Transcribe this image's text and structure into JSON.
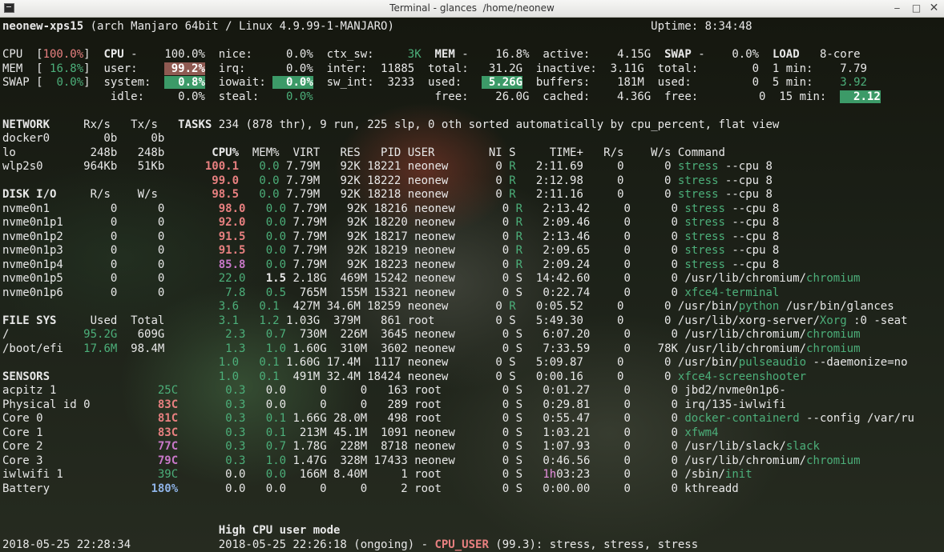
{
  "window": {
    "title": "Terminal - glances  /home/neonew"
  },
  "lines": [
    [
      {
        "t": "neonew-xps15",
        "c": "b"
      },
      {
        "t": " (arch Manjaro 64bit / Linux 4.9.99-1-MANJARO)                                      Uptime: 8:34:48"
      }
    ],
    [],
    [
      {
        "t": "CPU  ["
      },
      {
        "t": "100.0%",
        "c": "r"
      },
      {
        "t": "]  "
      },
      {
        "t": "CPU",
        "c": "b"
      },
      {
        "t": " -    100.0%  nice:     0.0%  ctx_sw:     "
      },
      {
        "t": "3K",
        "c": "g"
      },
      {
        "t": "  "
      },
      {
        "t": "MEM",
        "c": "b"
      },
      {
        "t": " -    16.8%  active:    4.15G  "
      },
      {
        "t": "SWAP",
        "c": "b"
      },
      {
        "t": " -    0.0%  "
      },
      {
        "t": "LOAD",
        "c": "b"
      },
      {
        "t": "   8-core"
      }
    ],
    [
      {
        "t": "MEM  [ "
      },
      {
        "t": "16.8%",
        "c": "g"
      },
      {
        "t": "]  user:    "
      },
      {
        "t": " 99.2%",
        "c": "hr b"
      },
      {
        "t": "  irq:      0.0%  inter:  11885  total:   31.2G  inactive:  3.11G  total:        0  1 min:    7.79"
      }
    ],
    [
      {
        "t": "SWAP [  "
      },
      {
        "t": "0.0%",
        "c": "g"
      },
      {
        "t": "]  system:  "
      },
      {
        "t": "  0.8%",
        "c": "hg b"
      },
      {
        "t": "  iowait: "
      },
      {
        "t": "  0.0%",
        "c": "hg b"
      },
      {
        "t": "  sw_int:  3233  used:   "
      },
      {
        "t": " 5.26G",
        "c": "hg b"
      },
      {
        "t": "  buffers:    181M  used:         0  5 min:    "
      },
      {
        "t": "3.92",
        "c": "g"
      }
    ],
    [
      {
        "t": "                idle:     0.0%  steal:    "
      },
      {
        "t": "0.0%",
        "c": "g"
      },
      {
        "t": "                  free:    26.0G  cached:    4.36G  free:         0  15 min:  "
      },
      {
        "t": "  2.12",
        "c": "hg b"
      }
    ],
    [],
    [
      {
        "t": "NETWORK",
        "c": "b"
      },
      {
        "t": "     Rx/s   Tx/s   "
      },
      {
        "t": "TASKS",
        "c": "b"
      },
      {
        "t": " 234 (878 thr), 9 run, 225 slp, 0 oth sorted automatically by cpu_percent, flat view"
      }
    ],
    [
      {
        "t": "docker0        0b     0b"
      }
    ],
    [
      {
        "t": "lo           248b   248b       "
      },
      {
        "t": "CPU%",
        "c": "b"
      },
      {
        "t": "  MEM%  VIRT   RES   PID USER        NI S     TIME+   R/s    W/s Command"
      }
    ],
    [
      {
        "t": "wlp2s0      964Kb   51Kb      "
      },
      {
        "t": "100.1",
        "c": "r b"
      },
      {
        "t": "   "
      },
      {
        "t": "0.0",
        "c": "g"
      },
      {
        "t": " 7.79M   92K 18221 neonew       0 "
      },
      {
        "t": "R",
        "c": "g"
      },
      {
        "t": "   2:11.69     0      0 "
      },
      {
        "t": "stress",
        "c": "g"
      },
      {
        "t": " --cpu 8"
      }
    ],
    [
      {
        "t": "                               "
      },
      {
        "t": "99.0",
        "c": "r b"
      },
      {
        "t": "   "
      },
      {
        "t": "0.0",
        "c": "g"
      },
      {
        "t": " 7.79M   92K 18222 neonew       0 "
      },
      {
        "t": "R",
        "c": "g"
      },
      {
        "t": "   2:12.98     0      0 "
      },
      {
        "t": "stress",
        "c": "g"
      },
      {
        "t": " --cpu 8"
      }
    ],
    [
      {
        "t": "DISK I/O",
        "c": "b"
      },
      {
        "t": "     R/s    W/s        "
      },
      {
        "t": "98.5",
        "c": "r b"
      },
      {
        "t": "   "
      },
      {
        "t": "0.0",
        "c": "g"
      },
      {
        "t": " 7.79M   92K 18218 neonew       0 "
      },
      {
        "t": "R",
        "c": "g"
      },
      {
        "t": "   2:11.16     0      0 "
      },
      {
        "t": "stress",
        "c": "g"
      },
      {
        "t": " --cpu 8"
      }
    ],
    [
      {
        "t": "nvme0n1         0      0        "
      },
      {
        "t": "98.0",
        "c": "r b"
      },
      {
        "t": "   "
      },
      {
        "t": "0.0",
        "c": "g"
      },
      {
        "t": " 7.79M   92K 18216 neonew       0 "
      },
      {
        "t": "R",
        "c": "g"
      },
      {
        "t": "   2:13.42     0      0 "
      },
      {
        "t": "stress",
        "c": "g"
      },
      {
        "t": " --cpu 8"
      }
    ],
    [
      {
        "t": "nvme0n1p1       0      0        "
      },
      {
        "t": "92.0",
        "c": "r b"
      },
      {
        "t": "   "
      },
      {
        "t": "0.0",
        "c": "g"
      },
      {
        "t": " 7.79M   92K 18220 neonew       0 "
      },
      {
        "t": "R",
        "c": "g"
      },
      {
        "t": "   2:09.46     0      0 "
      },
      {
        "t": "stress",
        "c": "g"
      },
      {
        "t": " --cpu 8"
      }
    ],
    [
      {
        "t": "nvme0n1p2       0      0        "
      },
      {
        "t": "91.5",
        "c": "r b"
      },
      {
        "t": "   "
      },
      {
        "t": "0.0",
        "c": "g"
      },
      {
        "t": " 7.79M   92K 18217 neonew       0 "
      },
      {
        "t": "R",
        "c": "g"
      },
      {
        "t": "   2:13.46     0      0 "
      },
      {
        "t": "stress",
        "c": "g"
      },
      {
        "t": " --cpu 8"
      }
    ],
    [
      {
        "t": "nvme0n1p3       0      0        "
      },
      {
        "t": "91.5",
        "c": "r b"
      },
      {
        "t": "   "
      },
      {
        "t": "0.0",
        "c": "g"
      },
      {
        "t": " 7.79M   92K 18219 neonew       0 "
      },
      {
        "t": "R",
        "c": "g"
      },
      {
        "t": "   2:09.65     0      0 "
      },
      {
        "t": "stress",
        "c": "g"
      },
      {
        "t": " --cpu 8"
      }
    ],
    [
      {
        "t": "nvme0n1p4       0      0        "
      },
      {
        "t": "85.8",
        "c": "m b"
      },
      {
        "t": "   "
      },
      {
        "t": "0.0",
        "c": "g"
      },
      {
        "t": " 7.79M   92K 18223 neonew       0 "
      },
      {
        "t": "R",
        "c": "g"
      },
      {
        "t": "   2:09.24     0      0 "
      },
      {
        "t": "stress",
        "c": "g"
      },
      {
        "t": " --cpu 8"
      }
    ],
    [
      {
        "t": "nvme0n1p5       0      0        "
      },
      {
        "t": "22.0",
        "c": "g"
      },
      {
        "t": "   "
      },
      {
        "t": "1.5",
        "c": "b"
      },
      {
        "t": " 2.18G  469M 15242 neonew       0 S  14:42.60     0      0 /usr/lib/chromium/"
      },
      {
        "t": "chromium",
        "c": "g"
      }
    ],
    [
      {
        "t": "nvme0n1p6       0      0         "
      },
      {
        "t": "7.8",
        "c": "g"
      },
      {
        "t": "   "
      },
      {
        "t": "0.5",
        "c": "g"
      },
      {
        "t": "  765M  155M 15321 neonew       0 S   0:22.74     0      0 "
      },
      {
        "t": "xfce4-terminal",
        "c": "g"
      }
    ],
    [
      {
        "t": "                                "
      },
      {
        "t": "3.6",
        "c": "g"
      },
      {
        "t": "   "
      },
      {
        "t": "0.1",
        "c": "g"
      },
      {
        "t": "  427M 34.6M 18259 neonew       0 "
      },
      {
        "t": "R",
        "c": "g"
      },
      {
        "t": "   0:05.52     0      0 /usr/bin/"
      },
      {
        "t": "python",
        "c": "g"
      },
      {
        "t": " /usr/bin/glances"
      }
    ],
    [
      {
        "t": "FILE SYS",
        "c": "b"
      },
      {
        "t": "     Used  Total        "
      },
      {
        "t": "3.1",
        "c": "g"
      },
      {
        "t": "   "
      },
      {
        "t": "1.2",
        "c": "g"
      },
      {
        "t": " 1.03G  379M   861 root         0 S   5:49.30     0      0 /usr/lib/xorg-server/"
      },
      {
        "t": "Xorg",
        "c": "g"
      },
      {
        "t": " :0 -seat"
      }
    ],
    [
      {
        "t": "/           "
      },
      {
        "t": "95.2G",
        "c": "g"
      },
      {
        "t": "   609G         "
      },
      {
        "t": "2.3",
        "c": "g"
      },
      {
        "t": "   "
      },
      {
        "t": "0.7",
        "c": "g"
      },
      {
        "t": "  730M  226M  3645 neonew       0 S   6:07.20     0      0 /usr/lib/chromium/"
      },
      {
        "t": "chromium",
        "c": "g"
      }
    ],
    [
      {
        "t": "/boot/efi   "
      },
      {
        "t": "17.6M",
        "c": "g"
      },
      {
        "t": "  98.4M         "
      },
      {
        "t": "1.3",
        "c": "g"
      },
      {
        "t": "   "
      },
      {
        "t": "1.0",
        "c": "g"
      },
      {
        "t": " 1.60G  310M  3602 neonew       0 S   7:33.59     0    78K /usr/lib/chromium/"
      },
      {
        "t": "chromium",
        "c": "g"
      }
    ],
    [
      {
        "t": "                                "
      },
      {
        "t": "1.0",
        "c": "g"
      },
      {
        "t": "   "
      },
      {
        "t": "0.1",
        "c": "g"
      },
      {
        "t": " 1.60G 17.4M  1117 neonew       0 S   5:09.87     0      0 /usr/bin/"
      },
      {
        "t": "pulseaudio",
        "c": "g"
      },
      {
        "t": " --daemonize=no"
      }
    ],
    [
      {
        "t": "SENSORS",
        "c": "b"
      },
      {
        "t": "                         "
      },
      {
        "t": "1.0",
        "c": "g"
      },
      {
        "t": "   "
      },
      {
        "t": "0.1",
        "c": "g"
      },
      {
        "t": "  491M 32.4M 18424 neonew       0 S   0:00.16     0      0 "
      },
      {
        "t": "xfce4-screenshooter",
        "c": "g"
      }
    ],
    [
      {
        "t": "acpitz 1               "
      },
      {
        "t": "25C",
        "c": "g"
      },
      {
        "t": "       "
      },
      {
        "t": "0.3",
        "c": "g"
      },
      {
        "t": "   0.0     0     0   163 root         0 S   0:01.27     0      0 jbd2/nvme0n1p6-"
      }
    ],
    [
      {
        "t": "Physical id 0          "
      },
      {
        "t": "83C",
        "c": "r b"
      },
      {
        "t": "       "
      },
      {
        "t": "0.3",
        "c": "g"
      },
      {
        "t": "   0.0     0     0   289 root         0 S   0:29.81     0      0 irq/135-iwlwifi"
      }
    ],
    [
      {
        "t": "Core 0                 "
      },
      {
        "t": "81C",
        "c": "r b"
      },
      {
        "t": "       "
      },
      {
        "t": "0.3",
        "c": "g"
      },
      {
        "t": "   "
      },
      {
        "t": "0.1",
        "c": "g"
      },
      {
        "t": " 1.66G 28.0M   498 root         0 S   0:55.47     0      0 "
      },
      {
        "t": "docker-containerd",
        "c": "g"
      },
      {
        "t": " --config /var/ru"
      }
    ],
    [
      {
        "t": "Core 1                 "
      },
      {
        "t": "83C",
        "c": "r b"
      },
      {
        "t": "       "
      },
      {
        "t": "0.3",
        "c": "g"
      },
      {
        "t": "   "
      },
      {
        "t": "0.1",
        "c": "g"
      },
      {
        "t": "  213M 45.1M  1091 neonew       0 S   1:03.21     0      0 "
      },
      {
        "t": "xfwm4",
        "c": "g"
      }
    ],
    [
      {
        "t": "Core 2                 "
      },
      {
        "t": "77C",
        "c": "m b"
      },
      {
        "t": "       "
      },
      {
        "t": "0.3",
        "c": "g"
      },
      {
        "t": "   "
      },
      {
        "t": "0.7",
        "c": "g"
      },
      {
        "t": " 1.78G  228M  8718 neonew       0 S   1:07.93     0      0 /usr/lib/slack/"
      },
      {
        "t": "slack",
        "c": "g"
      }
    ],
    [
      {
        "t": "Core 3                 "
      },
      {
        "t": "79C",
        "c": "m b"
      },
      {
        "t": "       "
      },
      {
        "t": "0.3",
        "c": "g"
      },
      {
        "t": "   "
      },
      {
        "t": "1.0",
        "c": "g"
      },
      {
        "t": " 1.47G  328M 17433 neonew       0 S   0:46.56     0      0 /usr/lib/chromium/"
      },
      {
        "t": "chromium",
        "c": "g"
      }
    ],
    [
      {
        "t": "iwlwifi 1              "
      },
      {
        "t": "39C",
        "c": "g"
      },
      {
        "t": "       0.0   "
      },
      {
        "t": "0.0",
        "c": "g"
      },
      {
        "t": "  166M 8.40M     1 root         0 S   "
      },
      {
        "t": "1h",
        "c": "pk"
      },
      {
        "t": "03:23     0      0 /sbin/"
      },
      {
        "t": "init",
        "c": "g"
      }
    ],
    [
      {
        "t": "Battery               "
      },
      {
        "t": "180%",
        "c": "bl b"
      },
      {
        "t": "       0.0   0.0     0     0     2 root         0 S   0:00.00     0      0 kthreadd"
      }
    ],
    [],
    [],
    [
      {
        "t": "                                "
      },
      {
        "t": "High CPU user mode",
        "c": "b"
      }
    ],
    [
      {
        "t": "2018-05-25 22:28:34             2018-05-25 22:26:18 (ongoing) - "
      },
      {
        "t": "CPU_USER",
        "c": "r b"
      },
      {
        "t": " (99.3): stress, stress, stress"
      }
    ]
  ]
}
